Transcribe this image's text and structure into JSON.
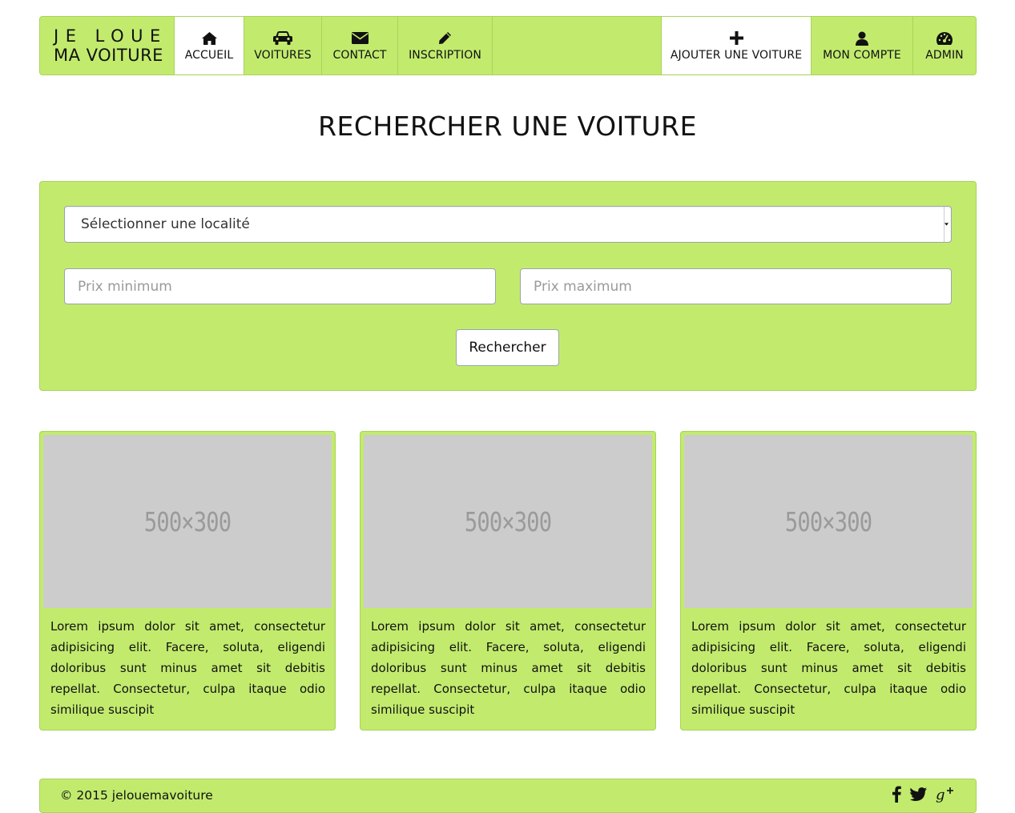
{
  "brand": {
    "line1": "JE LOUE",
    "line2": "MA VOITURE"
  },
  "nav": {
    "left": [
      {
        "label": "ACCUEIL",
        "icon": "home-icon",
        "active": true
      },
      {
        "label": "VOITURES",
        "icon": "car-icon",
        "active": false
      },
      {
        "label": "CONTACT",
        "icon": "envelope-icon",
        "active": false
      },
      {
        "label": "INSCRIPTION",
        "icon": "pencil-icon",
        "active": false
      }
    ],
    "right": [
      {
        "label": "AJOUTER UNE VOITURE",
        "icon": "plus-icon",
        "active": true
      },
      {
        "label": "MON COMPTE",
        "icon": "user-icon",
        "active": false
      },
      {
        "label": "ADMIN",
        "icon": "dashboard-icon",
        "active": false
      }
    ]
  },
  "page_title": "RECHERCHER UNE VOITURE",
  "search": {
    "locality_selected": "Sélectionner une localité",
    "min_price_placeholder": "Prix minimum",
    "max_price_placeholder": "Prix maximum",
    "submit_label": "Rechercher"
  },
  "cards": [
    {
      "image_label": "500×300",
      "text": "Lorem ipsum dolor sit amet, consectetur adipisicing elit. Facere, soluta, eligendi doloribus sunt minus amet sit debitis repellat. Consectetur, culpa itaque odio similique suscipit"
    },
    {
      "image_label": "500×300",
      "text": "Lorem ipsum dolor sit amet, consectetur adipisicing elit. Facere, soluta, eligendi doloribus sunt minus amet sit debitis repellat. Consectetur, culpa itaque odio similique suscipit"
    },
    {
      "image_label": "500×300",
      "text": "Lorem ipsum dolor sit amet, consectetur adipisicing elit. Facere, soluta, eligendi doloribus sunt minus amet sit debitis repellat. Consectetur, culpa itaque odio similique suscipit"
    }
  ],
  "footer": {
    "copyright": "© 2015 jelouemavoiture",
    "social": [
      "facebook-icon",
      "twitter-icon",
      "google-plus-icon"
    ]
  },
  "colors": {
    "accent": "#c2eb6e",
    "border": "#a9d25a",
    "placeholder_bg": "#cccccc"
  }
}
